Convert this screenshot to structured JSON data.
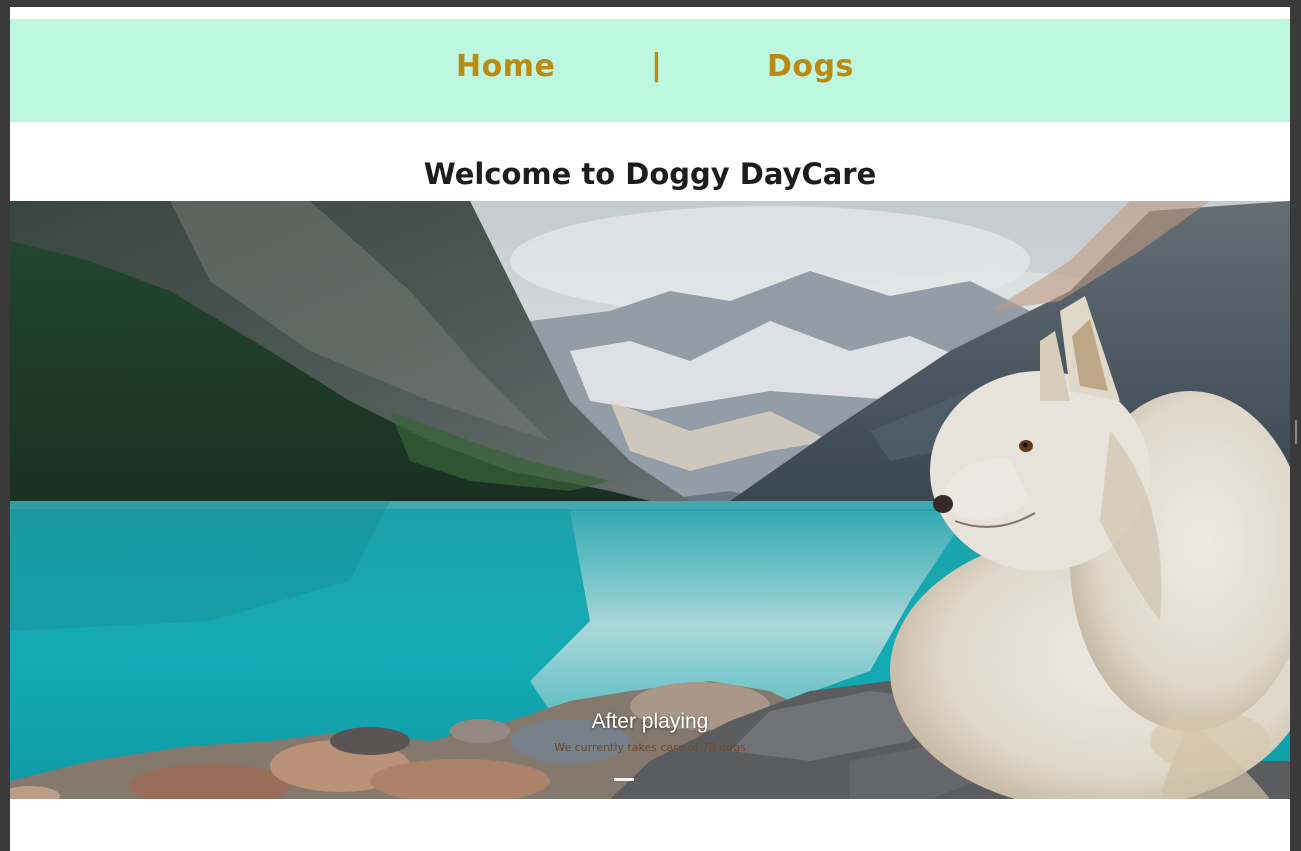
{
  "nav": {
    "home_label": "Home",
    "separator": "|",
    "dogs_label": "Dogs"
  },
  "main": {
    "title": "Welcome to Doggy DayCare"
  },
  "carousel": {
    "slide_title": "After playing",
    "slide_text": "We currently takes care of 78 dogs",
    "image_alt": "white dog lying by a turquoise mountain lake"
  },
  "colors": {
    "navbar_bg": "#bdf7e0",
    "nav_link": "#bb8a12",
    "heading": "#1d1d1d"
  }
}
